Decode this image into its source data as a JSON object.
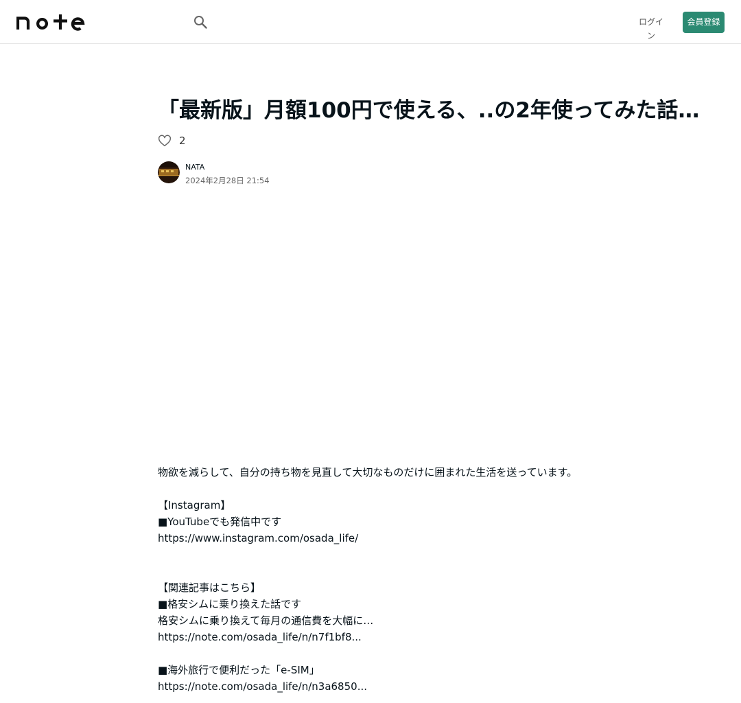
{
  "header": {
    "logo_text": "note",
    "login_label": "ログイン",
    "signup_label": "会員登録"
  },
  "article": {
    "title": "「最新版」月額100円で使える、..の2年使ってみた話…",
    "like_count": "2",
    "author_name": "NATA",
    "date": "2024年2月28日 21:54"
  },
  "body": {
    "intro": "物欲を減らして、自分の持ち物を見直して大切なものだけに囲まれた生活を送っています。",
    "instagram_heading": "【Instagram】",
    "youtube_line": "■YouTubeでも発信中です",
    "instagram_url": "https://www.instagram.com/osada_life/",
    "related_heading": "【関連記事はこちら】",
    "related_1_title": "■格安シムに乗り換えた話です",
    "related_1_desc": "格安シムに乗り換えて毎月の通信費を大幅に…",
    "related_1_url": "https://note.com/osada_life/n/n7f1bf8...",
    "related_2_title": "■海外旅行で便利だった「e-SIM」",
    "related_2_url": "https://note.com/osada_life/n/n3a6850..."
  },
  "colors": {
    "accent": "#2b8a72",
    "text": "#08131a"
  },
  "icons": {
    "search": "search-icon",
    "like": "heart-icon"
  }
}
